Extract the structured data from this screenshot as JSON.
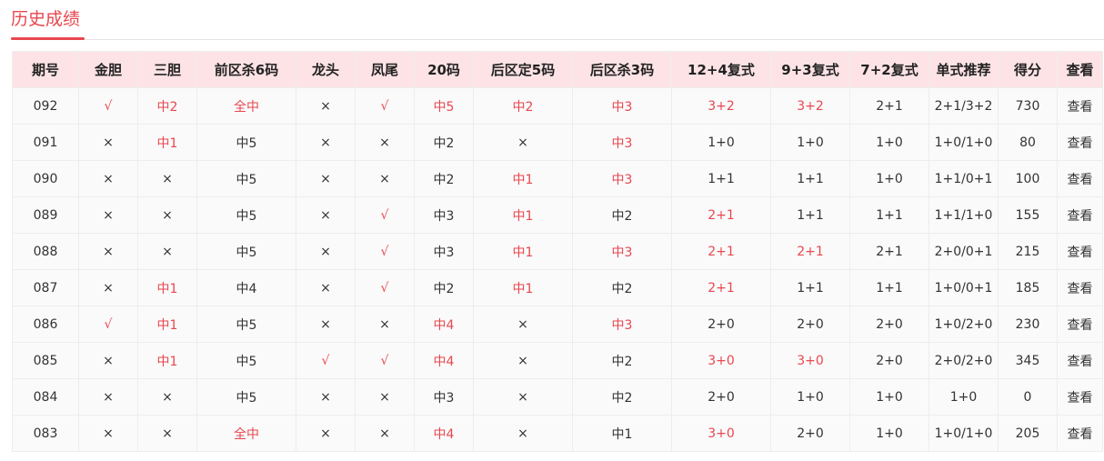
{
  "page_title": "历史成绩",
  "colors": {
    "accent": "#e8474f",
    "header_bg": "#fde3e6"
  },
  "table": {
    "headers": [
      "期号",
      "金胆",
      "三胆",
      "前区杀6码",
      "龙头",
      "凤尾",
      "20码",
      "后区定5码",
      "后区杀3码",
      "12+4复式",
      "9+3复式",
      "7+2复式",
      "单式推荐",
      "得分",
      "查看"
    ],
    "rows": [
      [
        "092",
        "√",
        "中2",
        "全中",
        "×",
        "√",
        "中5",
        "中2",
        "中3",
        "3+2",
        "3+2",
        "2+1",
        "2+1/3+2",
        "730",
        "查看"
      ],
      [
        "091",
        "×",
        "中1",
        "中5",
        "×",
        "×",
        "中2",
        "×",
        "中3",
        "1+0",
        "1+0",
        "1+0",
        "1+0/1+0",
        "80",
        "查看"
      ],
      [
        "090",
        "×",
        "×",
        "中5",
        "×",
        "×",
        "中2",
        "中1",
        "中3",
        "1+1",
        "1+1",
        "1+0",
        "1+1/0+1",
        "100",
        "查看"
      ],
      [
        "089",
        "×",
        "×",
        "中5",
        "×",
        "√",
        "中3",
        "中1",
        "中2",
        "2+1",
        "1+1",
        "1+1",
        "1+1/1+0",
        "155",
        "查看"
      ],
      [
        "088",
        "×",
        "×",
        "中5",
        "×",
        "√",
        "中3",
        "中1",
        "中3",
        "2+1",
        "2+1",
        "2+1",
        "2+0/0+1",
        "215",
        "查看"
      ],
      [
        "087",
        "×",
        "中1",
        "中4",
        "×",
        "√",
        "中2",
        "中1",
        "中2",
        "2+1",
        "1+1",
        "1+1",
        "1+0/0+1",
        "185",
        "查看"
      ],
      [
        "086",
        "√",
        "中1",
        "中5",
        "×",
        "×",
        "中4",
        "×",
        "中3",
        "2+0",
        "2+0",
        "2+0",
        "1+0/2+0",
        "230",
        "查看"
      ],
      [
        "085",
        "×",
        "中1",
        "中5",
        "√",
        "√",
        "中4",
        "×",
        "中2",
        "3+0",
        "3+0",
        "2+0",
        "2+0/2+0",
        "345",
        "查看"
      ],
      [
        "084",
        "×",
        "×",
        "中5",
        "×",
        "×",
        "中3",
        "×",
        "中2",
        "2+0",
        "1+0",
        "1+0",
        "1+0",
        "0",
        "查看"
      ],
      [
        "083",
        "×",
        "×",
        "全中",
        "×",
        "×",
        "中4",
        "×",
        "中1",
        "3+0",
        "2+0",
        "1+0",
        "1+0/1+0",
        "205",
        "查看"
      ]
    ],
    "highlight": [
      [
        0,
        1,
        1,
        1,
        0,
        1,
        1,
        1,
        1,
        1,
        1,
        0,
        0,
        0,
        0
      ],
      [
        0,
        0,
        1,
        0,
        0,
        0,
        0,
        0,
        1,
        0,
        0,
        0,
        0,
        0,
        0
      ],
      [
        0,
        0,
        0,
        0,
        0,
        0,
        0,
        1,
        1,
        0,
        0,
        0,
        0,
        0,
        0
      ],
      [
        0,
        0,
        0,
        0,
        0,
        1,
        0,
        1,
        0,
        1,
        0,
        0,
        0,
        0,
        0
      ],
      [
        0,
        0,
        0,
        0,
        0,
        1,
        0,
        1,
        1,
        1,
        1,
        0,
        0,
        0,
        0
      ],
      [
        0,
        0,
        1,
        0,
        0,
        1,
        0,
        1,
        0,
        1,
        0,
        0,
        0,
        0,
        0
      ],
      [
        0,
        1,
        1,
        0,
        0,
        0,
        1,
        0,
        1,
        0,
        0,
        0,
        0,
        0,
        0
      ],
      [
        0,
        0,
        1,
        0,
        1,
        1,
        1,
        0,
        0,
        1,
        1,
        0,
        0,
        0,
        0
      ],
      [
        0,
        0,
        0,
        0,
        0,
        0,
        0,
        0,
        0,
        0,
        0,
        0,
        0,
        0,
        0
      ],
      [
        0,
        0,
        0,
        1,
        0,
        0,
        1,
        0,
        0,
        1,
        0,
        0,
        0,
        0,
        0
      ]
    ]
  }
}
